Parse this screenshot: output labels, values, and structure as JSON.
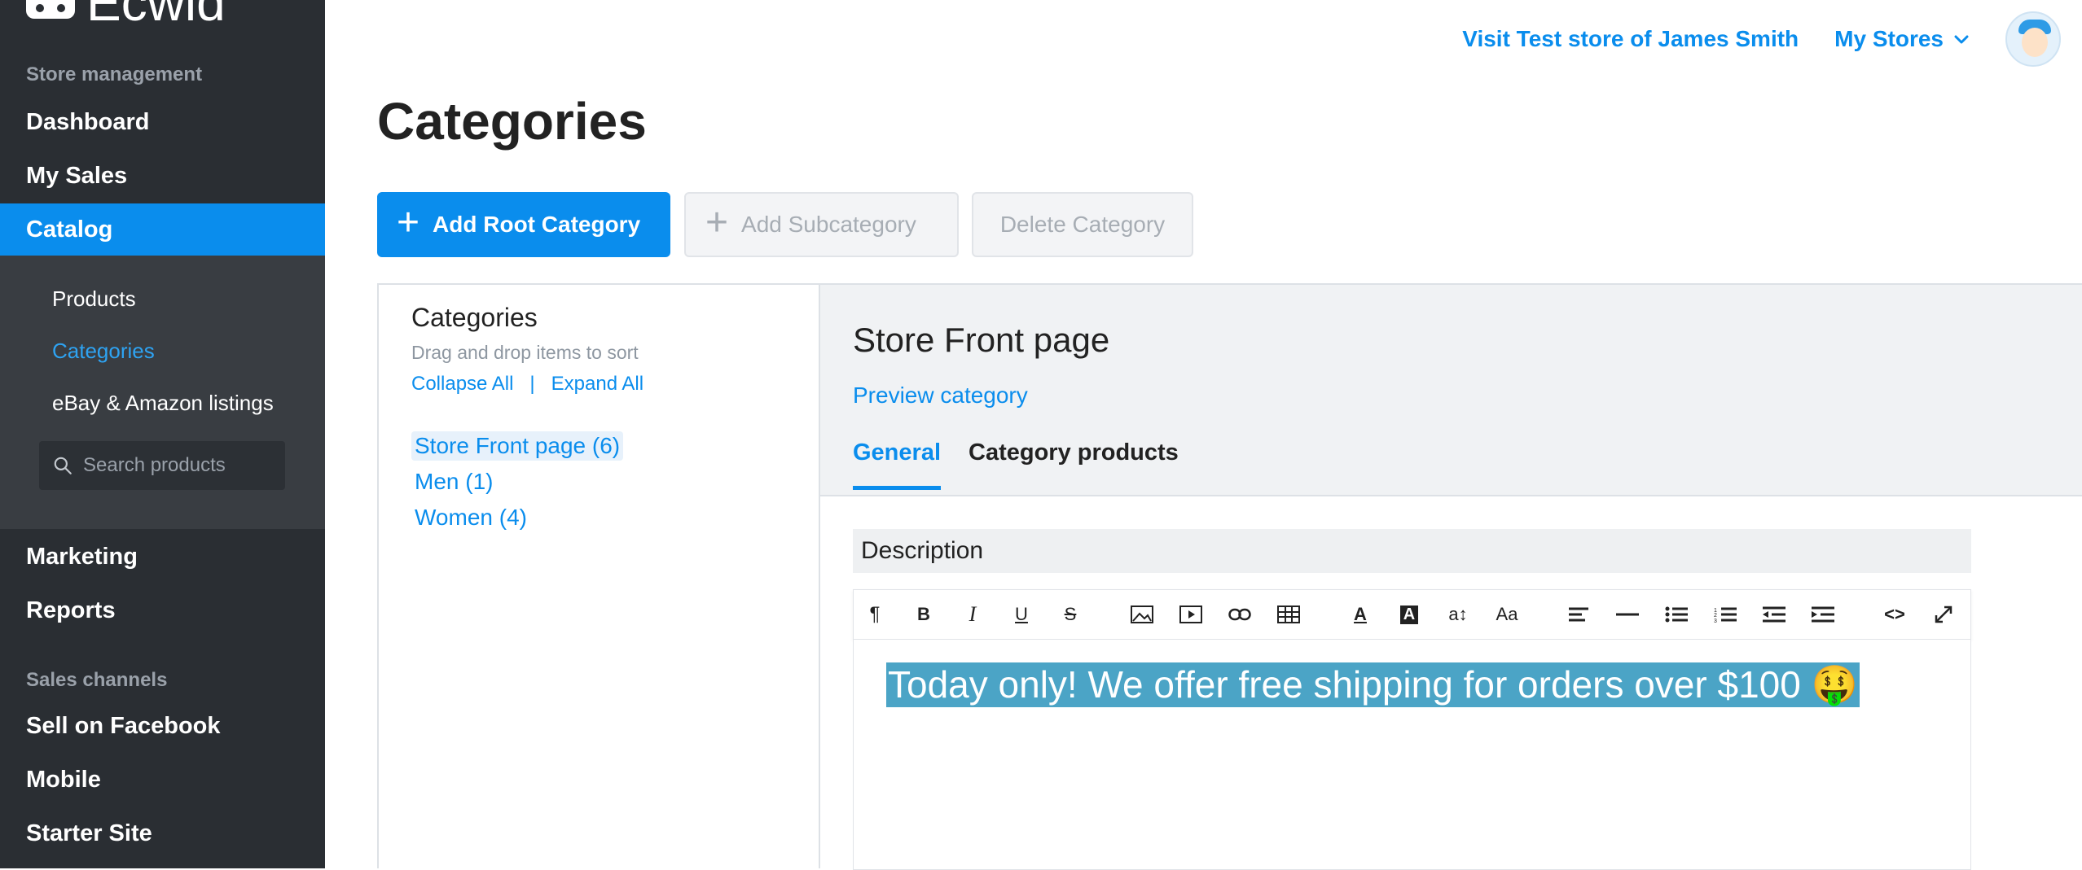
{
  "sidebar": {
    "brand": "Ecwid",
    "store_management_label": "Store management",
    "nav_top": [
      {
        "label": "Dashboard"
      },
      {
        "label": "My Sales"
      },
      {
        "label": "Catalog"
      }
    ],
    "catalog_sub": [
      {
        "label": "Products"
      },
      {
        "label": "Categories"
      },
      {
        "label": "eBay & Amazon listings"
      }
    ],
    "search_placeholder": "Search products",
    "nav_mid": [
      {
        "label": "Marketing"
      },
      {
        "label": "Reports"
      }
    ],
    "sales_channels_label": "Sales channels",
    "nav_channels": [
      {
        "label": "Sell on Facebook"
      },
      {
        "label": "Mobile"
      },
      {
        "label": "Starter Site"
      }
    ]
  },
  "header": {
    "visit_link": "Visit Test store of James Smith",
    "my_stores": "My Stores"
  },
  "page": {
    "title": "Categories",
    "add_root": "Add Root Category",
    "add_sub": "Add Subcategory",
    "delete": "Delete Category"
  },
  "left_panel": {
    "title": "Categories",
    "hint": "Drag and drop items to sort",
    "collapse": "Collapse All",
    "separator": "|",
    "expand": "Expand All",
    "tree": [
      {
        "label": "Store Front page (6)"
      },
      {
        "label": "Men (1)"
      },
      {
        "label": "Women (4)"
      }
    ]
  },
  "right_panel": {
    "title": "Store Front page",
    "preview": "Preview category",
    "tabs": [
      {
        "label": "General"
      },
      {
        "label": "Category products"
      }
    ],
    "description_label": "Description",
    "editor_text": "Today only! We offer free shipping for orders over $100 🤑"
  },
  "colors": {
    "accent": "#0a8ded",
    "sidebar_bg": "#2a2e33",
    "selection": "#4ba4c6"
  }
}
